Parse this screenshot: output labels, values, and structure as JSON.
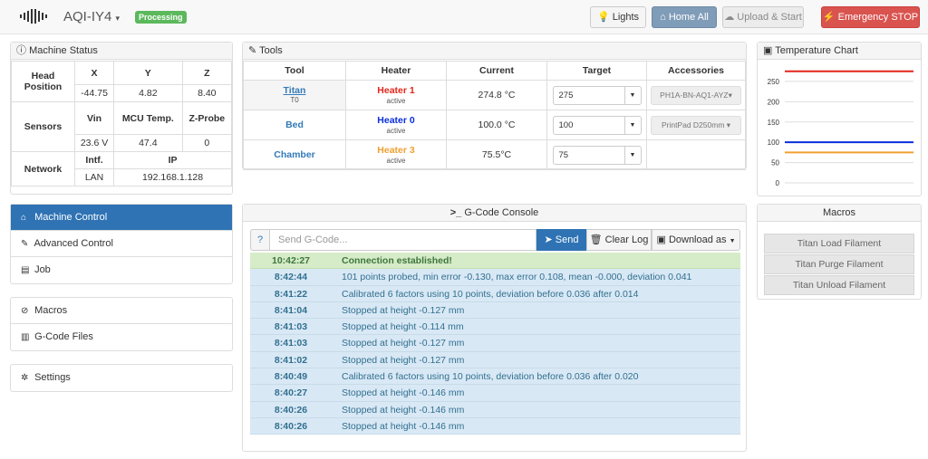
{
  "topbar": {
    "machine_name": "AQI-IY4",
    "machine_caret": "▾",
    "status_badge": "Processing",
    "lights_label": "Lights",
    "home_all_label": "Home All",
    "upload_start_label": "Upload & Start",
    "emergency_stop_label": "Emergency STOP"
  },
  "machine_status": {
    "title": "Machine Status",
    "head_position": {
      "label": "Head Position",
      "x_label": "X",
      "y_label": "Y",
      "z_label": "Z",
      "x": "-44.75",
      "y": "4.82",
      "z": "8.40"
    },
    "sensors": {
      "label": "Sensors",
      "vin_label": "Vin",
      "mcu_label": "MCU Temp.",
      "zprobe_label": "Z-Probe",
      "vin": "23.6 V",
      "mcu": "47.4",
      "zprobe": "0"
    },
    "network": {
      "label": "Network",
      "intf_label": "Intf.",
      "ip_label": "IP",
      "intf": "LAN",
      "ip": "192.168.1.128"
    }
  },
  "tools": {
    "title": "Tools",
    "headers": [
      "Tool",
      "Heater",
      "Current",
      "Target",
      "Accessories"
    ],
    "rows": [
      {
        "tool": "Titan",
        "tool_sub": "T0",
        "heater": "Heater 1",
        "heater_state": "active",
        "heater_color": "#e3261b",
        "current": "274.8 °C",
        "target": "275",
        "accessory": "PH1A-BN-AQ1-AYZ▾"
      },
      {
        "tool": "Bed",
        "tool_sub": "",
        "heater": "Heater 0",
        "heater_state": "active",
        "heater_color": "#0a2ee0",
        "current": "100.0 °C",
        "target": "100",
        "accessory": "PrintPad D250mm ▾"
      },
      {
        "tool": "Chamber",
        "tool_sub": "",
        "heater": "Heater 3",
        "heater_state": "active",
        "heater_color": "#f0a030",
        "current": "75.5°C",
        "target": "75",
        "accessory": ""
      }
    ]
  },
  "temperature_chart": {
    "title": "Temperature Chart",
    "chart_data": {
      "type": "line",
      "ylim": [
        0,
        290
      ],
      "yticks": [
        "250",
        "200",
        "150",
        "100",
        "50",
        "0"
      ],
      "series": [
        {
          "color": "#e3261b",
          "values": [
            275,
            275,
            275,
            275,
            275
          ]
        },
        {
          "color": "#0a2ee0",
          "values": [
            100,
            100,
            100,
            100,
            100
          ]
        },
        {
          "color": "#f0a030",
          "values": [
            75,
            75,
            75,
            75,
            75
          ]
        }
      ]
    }
  },
  "nav": {
    "group1": [
      {
        "label": "Machine Control",
        "icon": "⌂",
        "icon_name": "home-icon",
        "active": true
      },
      {
        "label": "Advanced Control",
        "icon": "✎",
        "icon_name": "wrench-icon",
        "active": false
      },
      {
        "label": "Job",
        "icon": "▤",
        "icon_name": "print-icon",
        "active": false
      }
    ],
    "group2": [
      {
        "label": "Macros",
        "icon": "⊘",
        "icon_name": "link-icon"
      },
      {
        "label": "G-Code Files",
        "icon": "▥",
        "icon_name": "hdd-icon"
      }
    ],
    "group3": [
      {
        "label": "Settings",
        "icon": "✲",
        "icon_name": "gear-icon"
      }
    ]
  },
  "console": {
    "title": "G-Code Console",
    "help_label": "?",
    "input_placeholder": "Send G-Code...",
    "send_label": "Send",
    "clear_label": "Clear Log",
    "download_label": "Download as",
    "log": [
      {
        "time": "10:42:27",
        "msg": "Connection established!",
        "ok": true
      },
      {
        "time": "8:42:44",
        "msg": "101 points probed, min error -0.130, max error 0.108, mean -0.000, deviation 0.041"
      },
      {
        "time": "8:41:22",
        "msg": "Calibrated 6 factors using 10 points, deviation before 0.036 after 0.014"
      },
      {
        "time": "8:41:04",
        "msg": "Stopped at height -0.127 mm"
      },
      {
        "time": "8:41:03",
        "msg": "Stopped at height -0.114 mm"
      },
      {
        "time": "8:41:03",
        "msg": "Stopped at height -0.127 mm"
      },
      {
        "time": "8:41:02",
        "msg": "Stopped at height -0.127 mm"
      },
      {
        "time": "8:40:49",
        "msg": "Calibrated 6 factors using 10 points, deviation before 0.036 after 0.020"
      },
      {
        "time": "8:40:27",
        "msg": "Stopped at height -0.146 mm"
      },
      {
        "time": "8:40:26",
        "msg": "Stopped at height -0.146 mm"
      },
      {
        "time": "8:40:26",
        "msg": "Stopped at height -0.146 mm"
      }
    ]
  },
  "macros": {
    "title": "Macros",
    "items": [
      "Titan Load Filament",
      "Titan Purge Filament",
      "Titan Unload Filament"
    ]
  }
}
